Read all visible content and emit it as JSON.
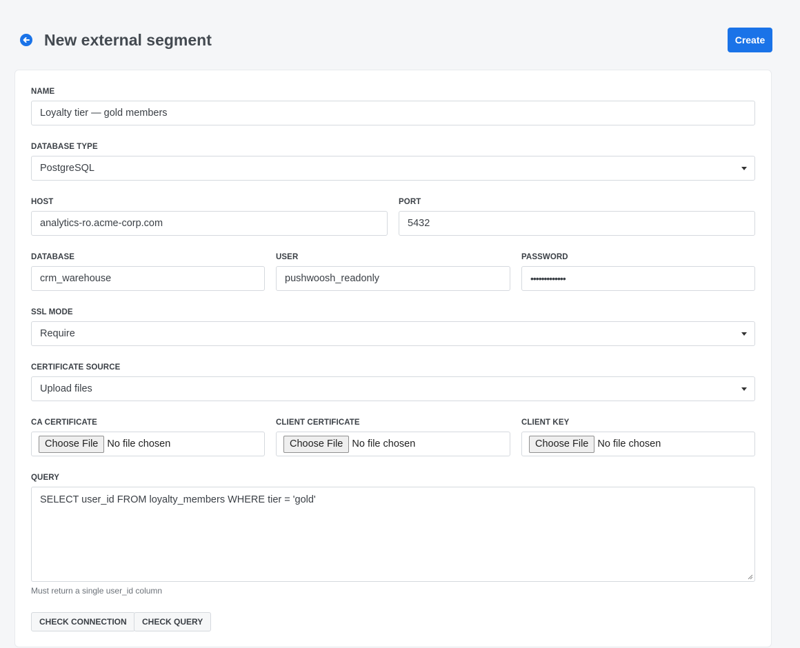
{
  "header": {
    "title": "New external segment",
    "back_icon": "arrow-left-circle-icon",
    "create_label": "Create"
  },
  "form": {
    "name": {
      "label": "NAME",
      "value": "Loyalty tier — gold members"
    },
    "database_type": {
      "label": "DATABASE TYPE",
      "value": "PostgreSQL"
    },
    "host": {
      "label": "HOST",
      "value": "analytics-ro.acme-corp.com"
    },
    "port": {
      "label": "PORT",
      "value": "5432"
    },
    "database": {
      "label": "DATABASE",
      "value": "crm_warehouse"
    },
    "user": {
      "label": "USER",
      "value": "pushwoosh_readonly"
    },
    "password": {
      "label": "PASSWORD",
      "value": "•••••••••••••"
    },
    "ssl_mode": {
      "label": "SSL MODE",
      "value": "Require"
    },
    "certificate_source": {
      "label": "CERTIFICATE SOURCE",
      "value": "Upload files"
    },
    "ca_certificate": {
      "label": "CA CERTIFICATE",
      "button": "Choose File",
      "status": "No file chosen"
    },
    "client_certificate": {
      "label": "CLIENT CERTIFICATE",
      "button": "Choose File",
      "status": "No file chosen"
    },
    "client_key": {
      "label": "CLIENT KEY",
      "button": "Choose File",
      "status": "No file chosen"
    },
    "query": {
      "label": "QUERY",
      "value": "SELECT user_id FROM loyalty_members WHERE tier = 'gold'",
      "hint": "Must return a single user_id column"
    }
  },
  "actions": {
    "check_connection": "CHECK CONNECTION",
    "check_query": "CHECK QUERY"
  },
  "colors": {
    "accent": "#1a73e8",
    "background": "#f5f6f8"
  }
}
